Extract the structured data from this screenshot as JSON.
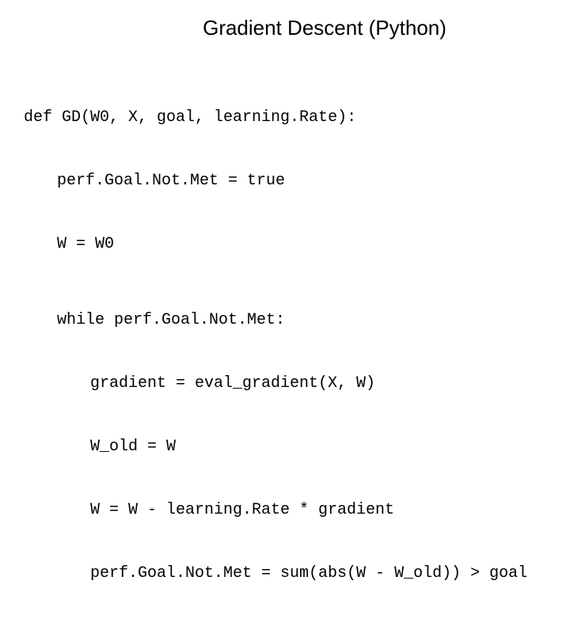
{
  "title": "Gradient Descent (Python)",
  "code": {
    "l1": "def GD(W0, X, goal, learning.Rate):",
    "l2": "perf.Goal.Not.Met = true",
    "l3": "W = W0",
    "l4": "while perf.Goal.Not.Met:",
    "l5": "gradient = eval_gradient(X, W)",
    "l6": "W_old = W",
    "l7": "W = W - learning.Rate * gradient",
    "l8": "perf.Goal.Not.Met = sum(abs(W - W_old)) > goal"
  }
}
